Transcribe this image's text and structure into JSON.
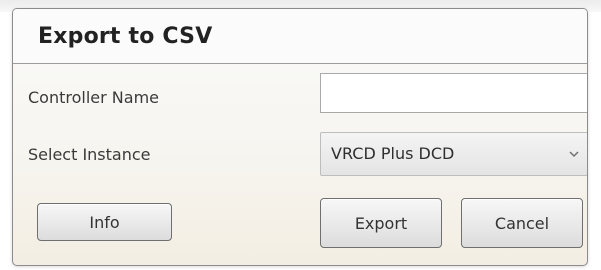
{
  "dialog": {
    "title": "Export to CSV"
  },
  "form": {
    "controller_name_label": "Controller Name",
    "controller_name_value": "",
    "select_instance_label": "Select Instance",
    "select_instance_value": "VRCD Plus DCD"
  },
  "buttons": {
    "info": "Info",
    "export": "Export",
    "cancel": "Cancel"
  },
  "icons": {
    "dropdown": "chevron-down-icon"
  },
  "colors": {
    "border": "#8c8c8c",
    "title_text": "#222222",
    "label_text": "#3a3a3a"
  }
}
